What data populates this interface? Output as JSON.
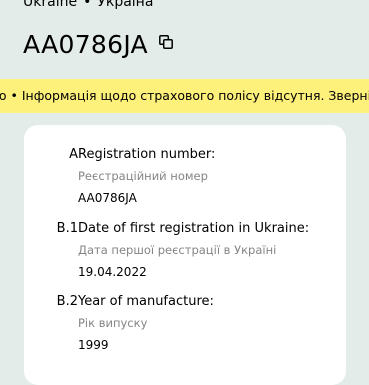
{
  "header": {
    "country_en": "Ukraine",
    "separator": "•",
    "country_uk": "Україна",
    "plate": "AA0786JA",
    "copy_icon": "copy-icon"
  },
  "banner": {
    "text": "ю • Інформація щодо страхового полісу відсутня. Зверніт",
    "background": "#fdf07b"
  },
  "details": [
    {
      "code": "A",
      "label": "Registration number:",
      "label_uk": "Реєстраційний номер",
      "value": "AA0786JA"
    },
    {
      "code": "B.1",
      "label": "Date of first registration in Ukraine:",
      "label_uk": "Дата першої реєстрації в Україні",
      "value": "19.04.2022"
    },
    {
      "code": "B.2",
      "label": "Year of manufacture:",
      "label_uk": "Рік випуску",
      "value": "1999"
    }
  ],
  "colors": {
    "page_background": "#e3ece8",
    "card_background": "#ffffff",
    "secondary_text": "#858585"
  }
}
